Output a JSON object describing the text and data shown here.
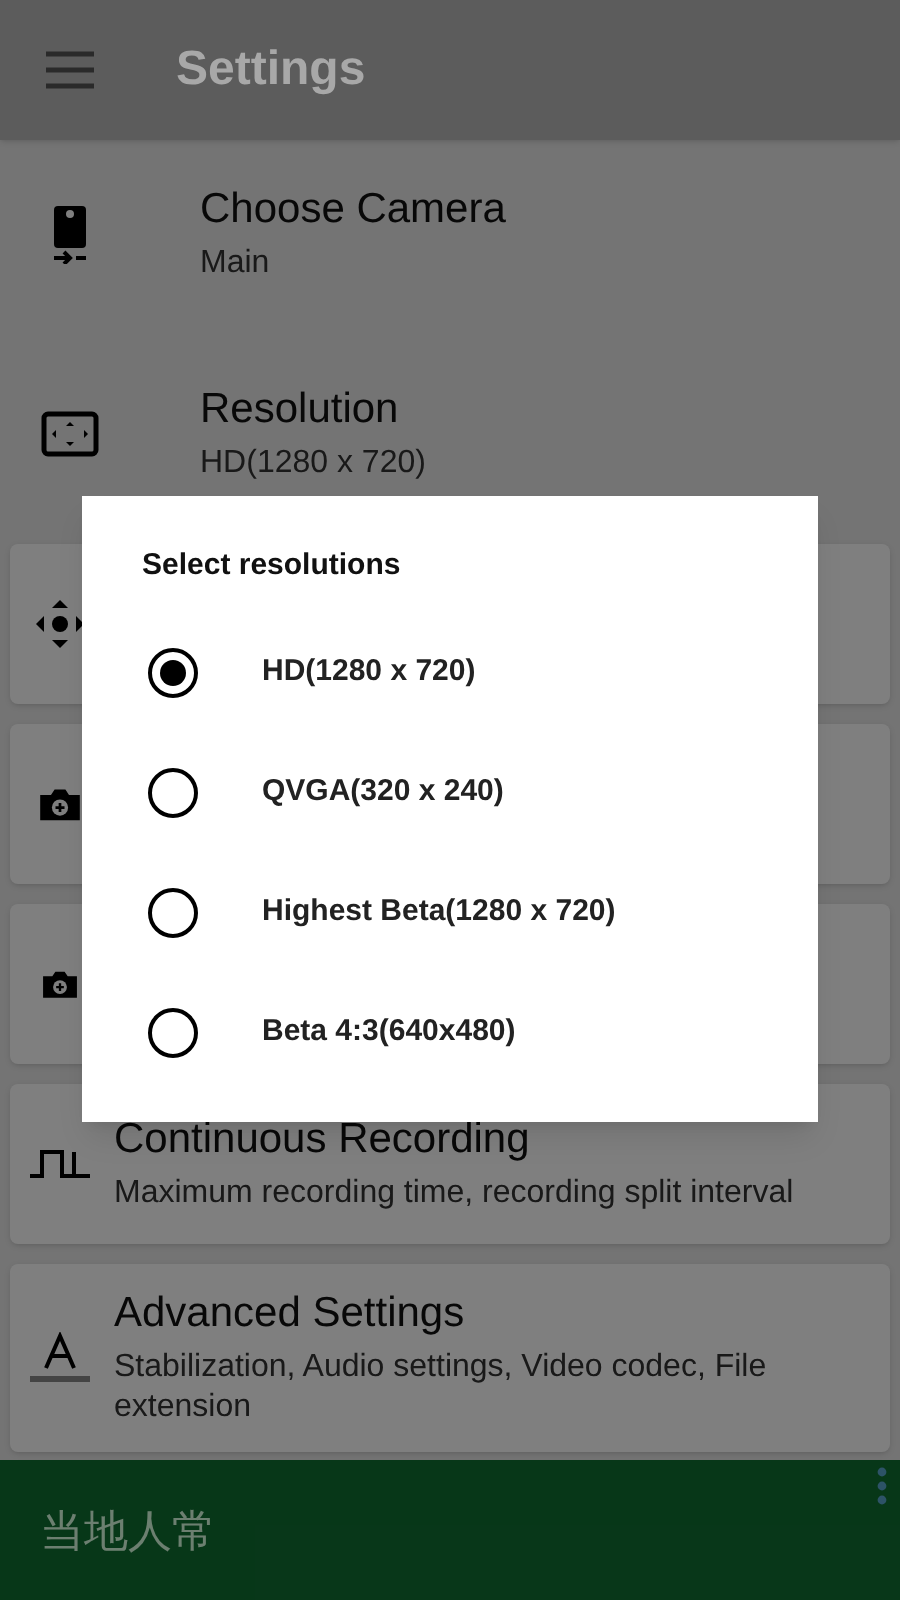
{
  "app_bar": {
    "title": "Settings"
  },
  "settings": [
    {
      "kind": "camera",
      "card": false,
      "title": "Choose Camera",
      "subtitle": "Main"
    },
    {
      "kind": "resolution",
      "card": false,
      "title": "Resolution",
      "subtitle": "HD(1280 x 720)"
    },
    {
      "kind": "move",
      "card": true
    },
    {
      "kind": "camera-plus",
      "card": true
    },
    {
      "kind": "camera-small",
      "card": true
    },
    {
      "kind": "pulse",
      "card": true,
      "title": "Continuous Recording",
      "subtitle": "Maximum recording time, recording split interval"
    },
    {
      "kind": "text",
      "card": true,
      "title": "Advanced Settings",
      "subtitle": "Stabilization, Audio settings, Video codec, File extension"
    }
  ],
  "ad_banner": {
    "text": "当地人常"
  },
  "dialog": {
    "title": "Select resolutions",
    "options": [
      {
        "label": "HD(1280 x 720)",
        "selected": true
      },
      {
        "label": "QVGA(320 x 240)",
        "selected": false
      },
      {
        "label": "Highest Beta(1280 x 720)",
        "selected": false
      },
      {
        "label": "Beta 4:3(640x480)",
        "selected": false
      }
    ]
  }
}
